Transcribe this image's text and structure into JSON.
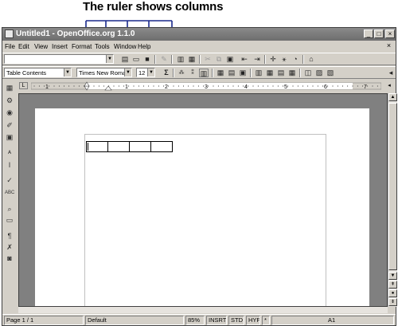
{
  "callout": {
    "text": "The ruler shows columns"
  },
  "window": {
    "title": "Untitled1 - OpenOffice.org 1.1.0",
    "minimize": "_",
    "maximize": "□",
    "close": "×"
  },
  "menubar": {
    "items": [
      "File",
      "Edit",
      "View",
      "Insert",
      "Format",
      "Tools",
      "Window",
      "Help"
    ],
    "close": "×"
  },
  "toolbar": {
    "url_value": "",
    "style_value": "Table Contents",
    "font_value": "Times New Roman",
    "size_value": "12",
    "dropdown_arrow": "▼",
    "sum_symbol": "Σ"
  },
  "ruler": {
    "corner_symbol": "L",
    "numbers": [
      "1",
      "1",
      "2",
      "3",
      "4",
      "5",
      "6",
      "7"
    ],
    "scroll_arrow": "◂"
  },
  "scrollbar": {
    "up": "▲",
    "down": "▼",
    "prev": "⇞",
    "nav": "●",
    "next": "⇟"
  },
  "statusbar": {
    "page": "Page 1 / 1",
    "style": "Default",
    "zoom": "85%",
    "insert_mode": "INSRT",
    "selection_mode": "STD",
    "hyperlink_mode": "HYP",
    "modified": "*",
    "cell": "A1"
  },
  "icons": {
    "open": "📂",
    "save": "💾",
    "print": "🖶",
    "cut": "✂",
    "copy": "⎘",
    "paste": "📋",
    "undo": "↶",
    "redo": "↷",
    "navigator": "✛",
    "gallery": "🖼",
    "bold": "B",
    "italic": "I",
    "underline": "U"
  }
}
